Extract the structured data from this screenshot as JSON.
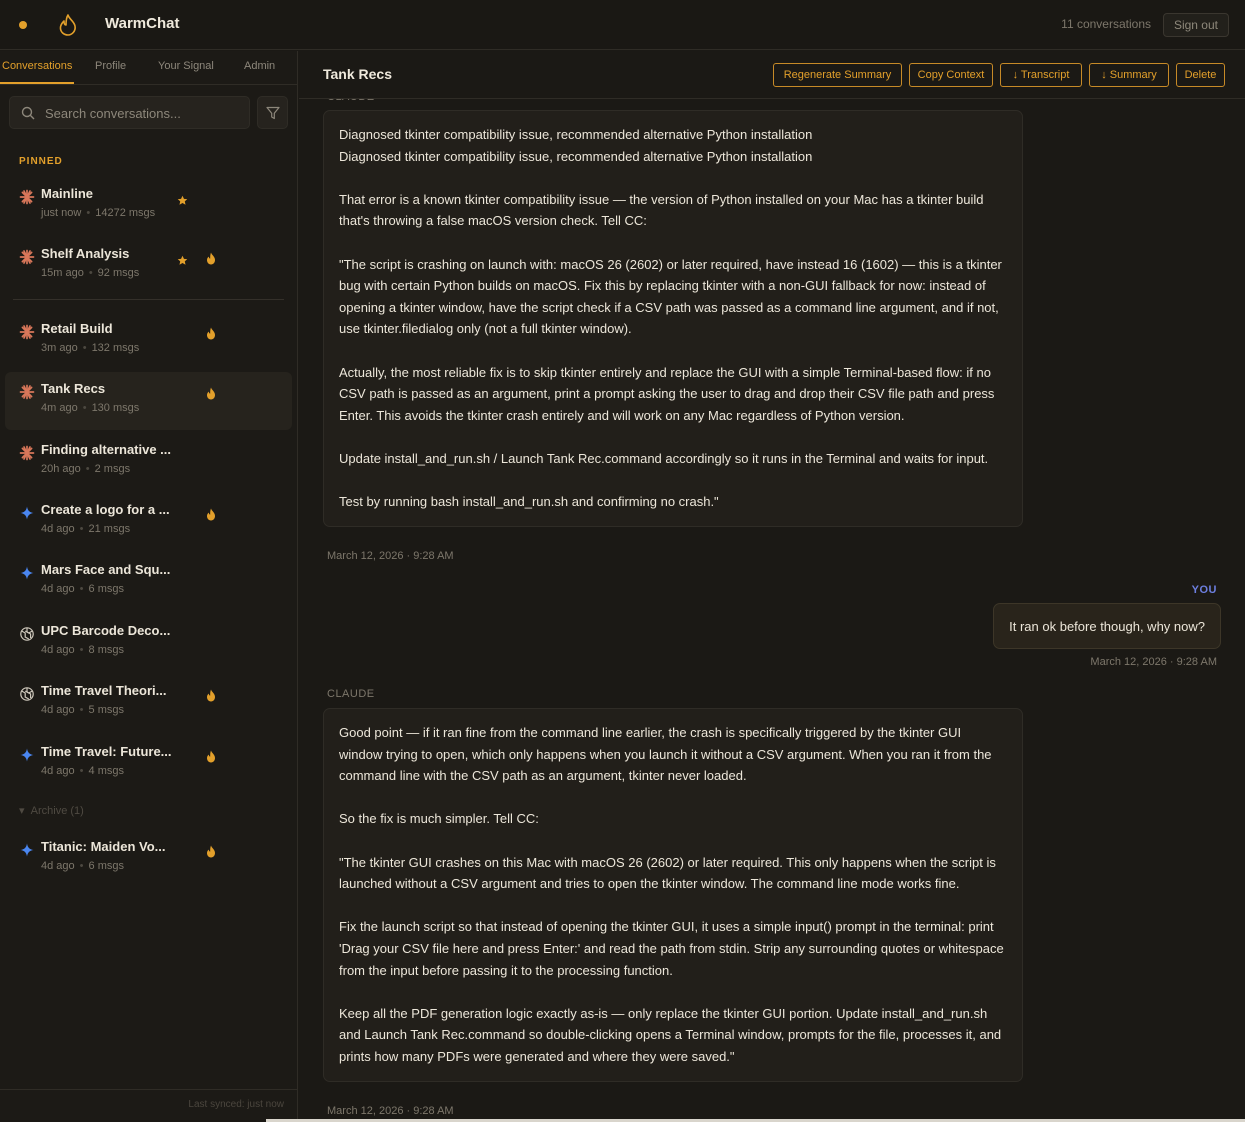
{
  "app": {
    "title": "WarmChat",
    "conversations_count": "11 conversations",
    "sign_out_label": "Sign out"
  },
  "colors": {
    "accent": "#e3a02b",
    "you_label": "#6d7fe0",
    "background": "#1b1915"
  },
  "sidebar": {
    "tabs": [
      {
        "label": "Conversations",
        "active": true
      },
      {
        "label": "Profile"
      },
      {
        "label": "Your Signal"
      },
      {
        "label": "Admin"
      }
    ],
    "search_placeholder": "Search conversations...",
    "pinned_label": "PINNED",
    "conversations": [
      {
        "name": "Mainline",
        "time": "just now",
        "msgs": "14272 msgs",
        "icon": "claude-icon",
        "starred": true,
        "hot": false
      },
      {
        "name": "Shelf Analysis",
        "time": "15m ago",
        "msgs": "92 msgs",
        "icon": "claude-icon",
        "starred": true,
        "hot": true
      },
      {
        "name": "Retail Build",
        "time": "3m ago",
        "msgs": "132 msgs",
        "icon": "claude-icon",
        "starred": false,
        "hot": true
      },
      {
        "name": "Tank Recs",
        "time": "4m ago",
        "msgs": "130 msgs",
        "icon": "claude-icon",
        "starred": false,
        "hot": true,
        "active": true
      },
      {
        "name": "Finding alternative ...",
        "time": "20h ago",
        "msgs": "2 msgs",
        "icon": "claude-icon",
        "starred": false,
        "hot": false
      },
      {
        "name": "Create a logo for a ...",
        "time": "4d ago",
        "msgs": "21 msgs",
        "icon": "gemini-icon",
        "starred": false,
        "hot": true
      },
      {
        "name": "Mars Face and Squ...",
        "time": "4d ago",
        "msgs": "6 msgs",
        "icon": "gemini-icon",
        "starred": false,
        "hot": false
      },
      {
        "name": "UPC Barcode Deco...",
        "time": "4d ago",
        "msgs": "8 msgs",
        "icon": "openai-icon",
        "starred": false,
        "hot": false
      },
      {
        "name": "Time Travel Theori...",
        "time": "4d ago",
        "msgs": "5 msgs",
        "icon": "openai-icon",
        "starred": false,
        "hot": true
      },
      {
        "name": "Time Travel: Future...",
        "time": "4d ago",
        "msgs": "4 msgs",
        "icon": "gemini-icon",
        "starred": false,
        "hot": true
      }
    ],
    "archive_label": "Archive (1)",
    "archived": [
      {
        "name": "Titanic: Maiden Vo...",
        "time": "4d ago",
        "msgs": "6 msgs",
        "icon": "gemini-icon",
        "starred": false,
        "hot": true
      }
    ],
    "last_synced": "Last synced: just now"
  },
  "main": {
    "title": "Tank Recs",
    "actions": [
      "Regenerate Summary",
      "Copy Context",
      "↓ Transcript",
      "↓ Summary",
      "Delete"
    ],
    "top_role_label": "CLAUDE",
    "messages": [
      {
        "role": "CLAUDE",
        "paragraphs": [
          "Diagnosed tkinter compatibility issue, recommended alternative Python installation\nDiagnosed tkinter compatibility issue, recommended alternative Python installation",
          "That error is a known tkinter compatibility issue — the version of Python installed on your Mac has a tkinter build that's throwing a false macOS version check. Tell CC:",
          "\"The script is crashing on launch with: macOS 26 (2602) or later required, have instead 16 (1602) — this is a tkinter bug with certain Python builds on macOS. Fix this by replacing tkinter with a non-GUI fallback for now: instead of opening a tkinter window, have the script check if a CSV path was passed as a command line argument, and if not, use tkinter.filedialog only (not a full tkinter window).",
          "Actually, the most reliable fix is to skip tkinter entirely and replace the GUI with a simple Terminal-based flow: if no CSV path is passed as an argument, print a prompt asking the user to drag and drop their CSV file path and press Enter. This avoids the tkinter crash entirely and will work on any Mac regardless of Python version.",
          "Update install_and_run.sh / Launch Tank Rec.command accordingly so it runs in the Terminal and waits for input.",
          "Test by running bash install_and_run.sh and confirming no crash.\""
        ],
        "timestamp": "March 12, 2026 · 9:28 AM"
      },
      {
        "role": "YOU",
        "text": "It ran ok before though, why now?",
        "timestamp": "March 12, 2026 · 9:28 AM"
      },
      {
        "role": "CLAUDE",
        "paragraphs": [
          "Good point — if it ran fine from the command line earlier, the crash is specifically triggered by the tkinter GUI window trying to open, which only happens when you launch it without a CSV argument. When you ran it from the command line with the CSV path as an argument, tkinter never loaded.",
          "So the fix is much simpler. Tell CC:",
          "\"The tkinter GUI crashes on this Mac with macOS 26 (2602) or later required. This only happens when the script is launched without a CSV argument and tries to open the tkinter window. The command line mode works fine.",
          "Fix the launch script so that instead of opening the tkinter GUI, it uses a simple input() prompt in the terminal: print 'Drag your CSV file here and press Enter:' and read the path from stdin. Strip any surrounding quotes or whitespace from the input before passing it to the processing function.",
          "Keep all the PDF generation logic exactly as-is — only replace the tkinter GUI portion. Update install_and_run.sh and Launch Tank Rec.command so double-clicking opens a Terminal window, prompts for the file, processes it, and prints how many PDFs were generated and where they were saved.\""
        ],
        "timestamp": "March 12, 2026 · 9:28 AM"
      }
    ]
  }
}
